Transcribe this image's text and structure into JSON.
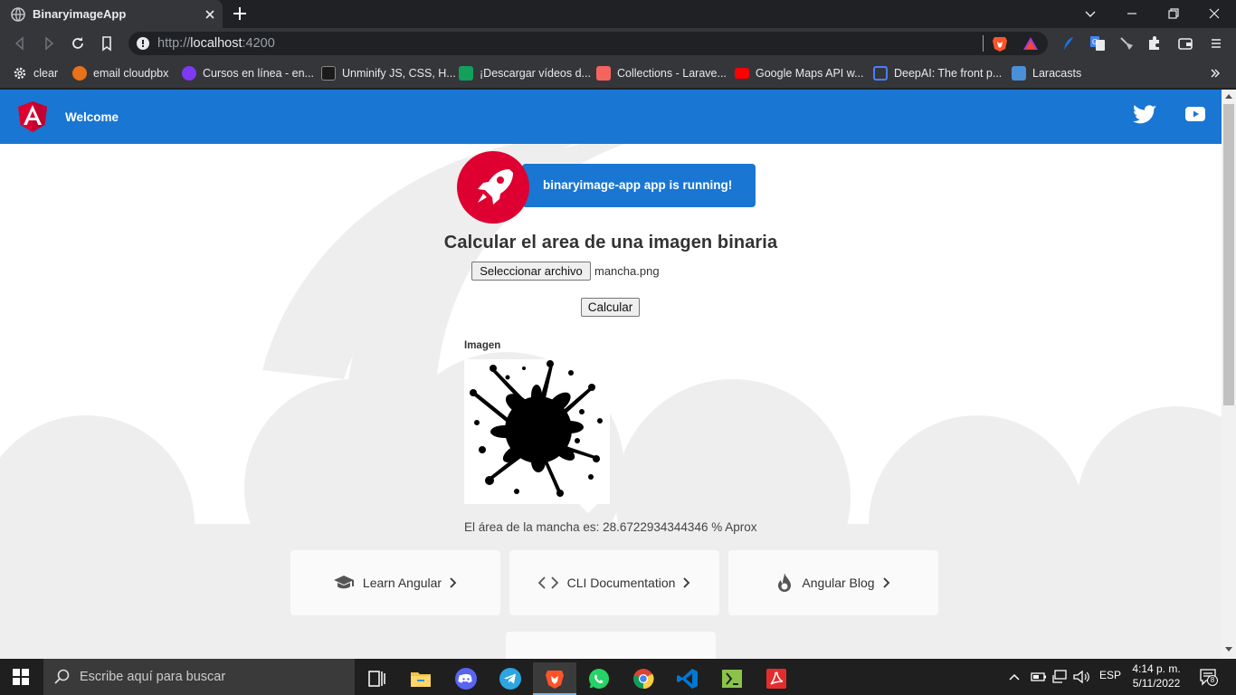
{
  "browser": {
    "tab_title": "BinaryimageApp",
    "url_host": "localhost",
    "url_prefix": "http://",
    "url_port": ":4200",
    "bookmarks": [
      {
        "label": "clear",
        "color": "#5f6368"
      },
      {
        "label": "email cloudpbx",
        "color": "#e8711a"
      },
      {
        "label": "Cursos en línea - en...",
        "color": "#7e3af2"
      },
      {
        "label": "Unminify JS, CSS, H...",
        "color": "#1b1b1b"
      },
      {
        "label": "¡Descargar vídeos d...",
        "color": "#12a05c"
      },
      {
        "label": "Collections - Larave...",
        "color": "#f4645f"
      },
      {
        "label": "Google Maps API w...",
        "color": "#ff0000"
      },
      {
        "label": "DeepAI: The front p...",
        "color": "#4a7dff"
      },
      {
        "label": "Laracasts",
        "color": "#4a90d9"
      }
    ]
  },
  "page": {
    "nav_welcome": "Welcome",
    "running_text": "binaryimage-app app is running!",
    "heading": "Calcular el area de una imagen binaria",
    "file_button": "Seleccionar archivo",
    "file_name": "mancha.png",
    "calc_button": "Calcular",
    "image_label": "Imagen",
    "result_text": "El área de la mancha es: 28.6722934344346 % Aprox",
    "cards": [
      {
        "label": "Learn Angular",
        "icon": "graduation-cap-icon"
      },
      {
        "label": "CLI Documentation",
        "icon": "code-icon"
      },
      {
        "label": "Angular Blog",
        "icon": "flame-icon"
      }
    ],
    "colors": {
      "primary": "#1976d2",
      "angular_red": "#dd0031"
    }
  },
  "taskbar": {
    "search_placeholder": "Escribe aquí para buscar",
    "language": "ESP",
    "time": "4:14 p. m.",
    "date": "5/11/2022",
    "notification_count": "8"
  }
}
